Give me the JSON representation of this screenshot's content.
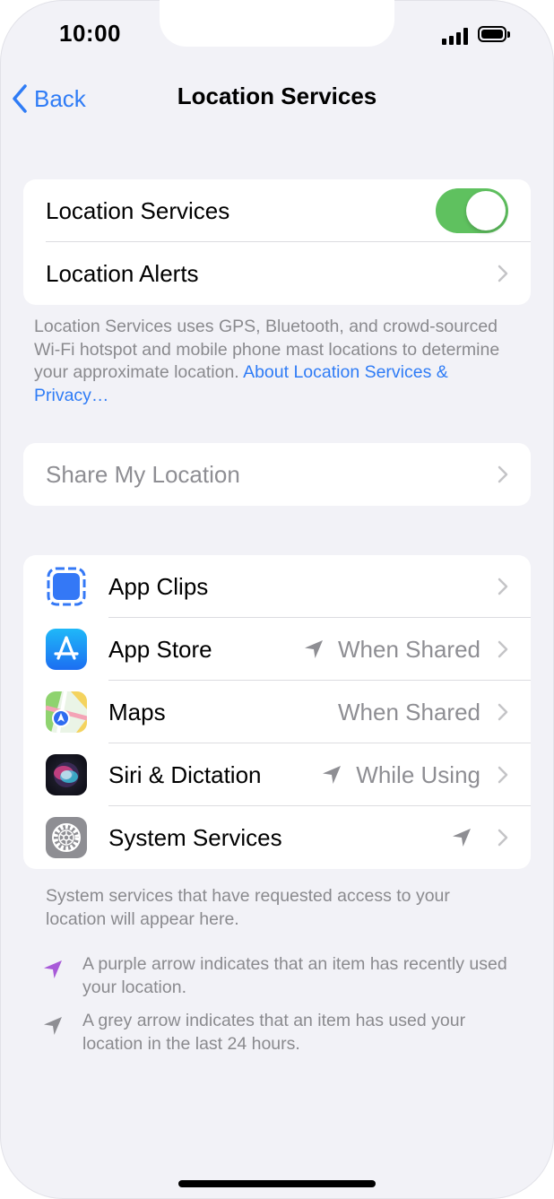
{
  "status_bar": {
    "time": "10:00"
  },
  "nav": {
    "back_label": "Back",
    "title": "Location Services"
  },
  "location_group": {
    "location_services_label": "Location Services",
    "location_services_enabled": true,
    "location_alerts_label": "Location Alerts"
  },
  "description": {
    "text": "Location Services uses GPS, Bluetooth, and crowd-sourced Wi-Fi hotspot and mobile phone mast locations to determine your approximate location. ",
    "link": "About Location Services & Privacy…"
  },
  "share_my_location": {
    "label": "Share My Location"
  },
  "apps": [
    {
      "name": "App Clips",
      "value": "",
      "arrow": false
    },
    {
      "name": "App Store",
      "value": "When Shared",
      "arrow": true
    },
    {
      "name": "Maps",
      "value": "When Shared",
      "arrow": false
    },
    {
      "name": "Siri & Dictation",
      "value": "While Using",
      "arrow": true
    },
    {
      "name": "System Services",
      "value": "",
      "arrow": true
    }
  ],
  "footer": {
    "system_note": "System services that have requested access to your location will appear here.",
    "purple_note": "A purple arrow indicates that an item has recently used your location.",
    "grey_note": "A grey arrow indicates that an item has used your location in the last 24 hours."
  },
  "colors": {
    "accent": "#2f7cf6",
    "toggle_on": "#5fc15f",
    "purple_arrow": "#a85ad8",
    "grey_arrow": "#8e8e93",
    "background": "#f2f2f7"
  },
  "icons": {
    "back": "chevron-left-icon",
    "disclosure": "chevron-right-icon",
    "location": "location-arrow-icon",
    "app_clips": "app-clips-icon",
    "app_store": "app-store-icon",
    "maps": "maps-icon",
    "siri": "siri-icon",
    "system_services": "settings-gear-icon"
  }
}
